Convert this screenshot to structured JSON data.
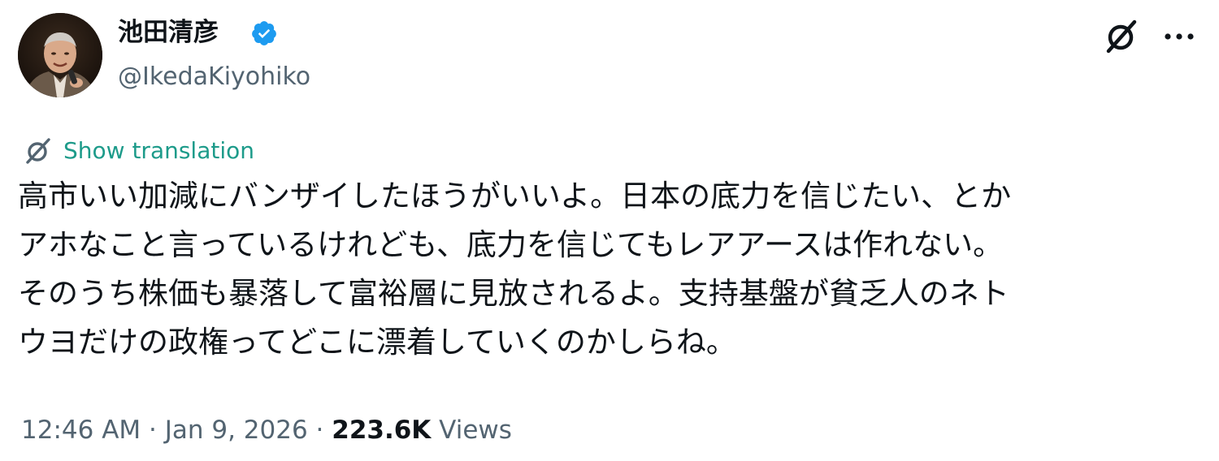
{
  "author": {
    "display_name": "池田清彦",
    "handle": "@IkedaKiyohiko",
    "verified": true
  },
  "actions": {
    "grok_icon": "grok-icon",
    "more_icon": "more-icon"
  },
  "translation": {
    "label": "Show translation"
  },
  "tweet": {
    "lines": [
      "高市いい加減にバンザイしたほうがいいよ。日本の底力を信じたい、とか",
      "アホなこと言っているけれども、底力を信じてもレアアースは作れない。",
      "そのうち株価も暴落して富裕層に見放されるよ。支持基盤が貧乏人のネト",
      "ウヨだけの政権ってどこに漂着していくのかしらね。"
    ]
  },
  "meta": {
    "time": "12:46 AM",
    "separator1": " · ",
    "date": "Jan 9, 2026",
    "separator2": " · ",
    "views_count": "223.6K",
    "views_label": " Views"
  },
  "colors": {
    "text_primary": "#0f1419",
    "text_secondary": "#536471",
    "verified_blue": "#1d9bf0",
    "translate_teal": "#1d9b8a"
  }
}
